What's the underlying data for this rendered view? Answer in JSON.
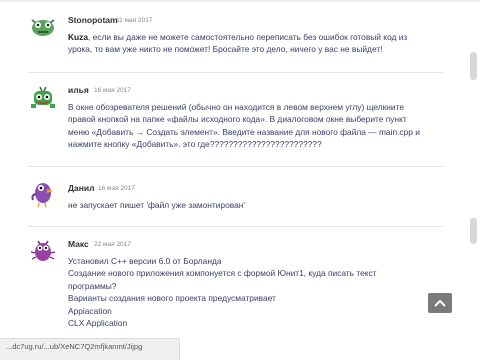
{
  "comments": [
    {
      "author": "Stonopotam",
      "date": "11 мая 2017",
      "avatar": "green-monster-avatar",
      "highlight": "Kuza",
      "text": ", если вы даже не можете самостоятельно переписать без ошибок готовый код из урока, то вам уже никто не поможет! Бросайте это дело, ничего у вас не выйдет!"
    },
    {
      "author": "илья",
      "date": "16 мая 2017",
      "avatar": "green-robot-avatar",
      "text": "В окне обозревателя решений (обычно он находится в левом верхнем углу) щелкните\nправой кнопкой на папке «файлы исходного кода». В диалоговом окне выберите пункт\nменю «Добавить → Создать элемент». Введите название для нового файла — main.cpp и\nнажмите кнопку «Добавить». это где????????????????????????"
    },
    {
      "author": "Данил",
      "date": "16 мая 2017",
      "avatar": "purple-bird-avatar",
      "text": "не запускает пишет 'файл уже замонтирован'"
    },
    {
      "author": "Макс",
      "date": "22 мая 2017",
      "avatar": "purple-bug-avatar",
      "text": "Установил С++ версии 6.0 от Борланда\nСоздание нового приложения компонуется с формой Юнит1, куда писать текст\nпрограммы?\nВарианты создания нового проекта предусматривает\nAppiacation\nCLX Application"
    }
  ],
  "status_url": "...dc7ug.ru/...ub/XeNC7Q2mfjkanmt/Jijpg",
  "colors": {
    "text": "#3a3f6b",
    "scroll_button": "#7a7a7a"
  },
  "icons": {
    "scroll_top": "chevron-up-icon"
  }
}
